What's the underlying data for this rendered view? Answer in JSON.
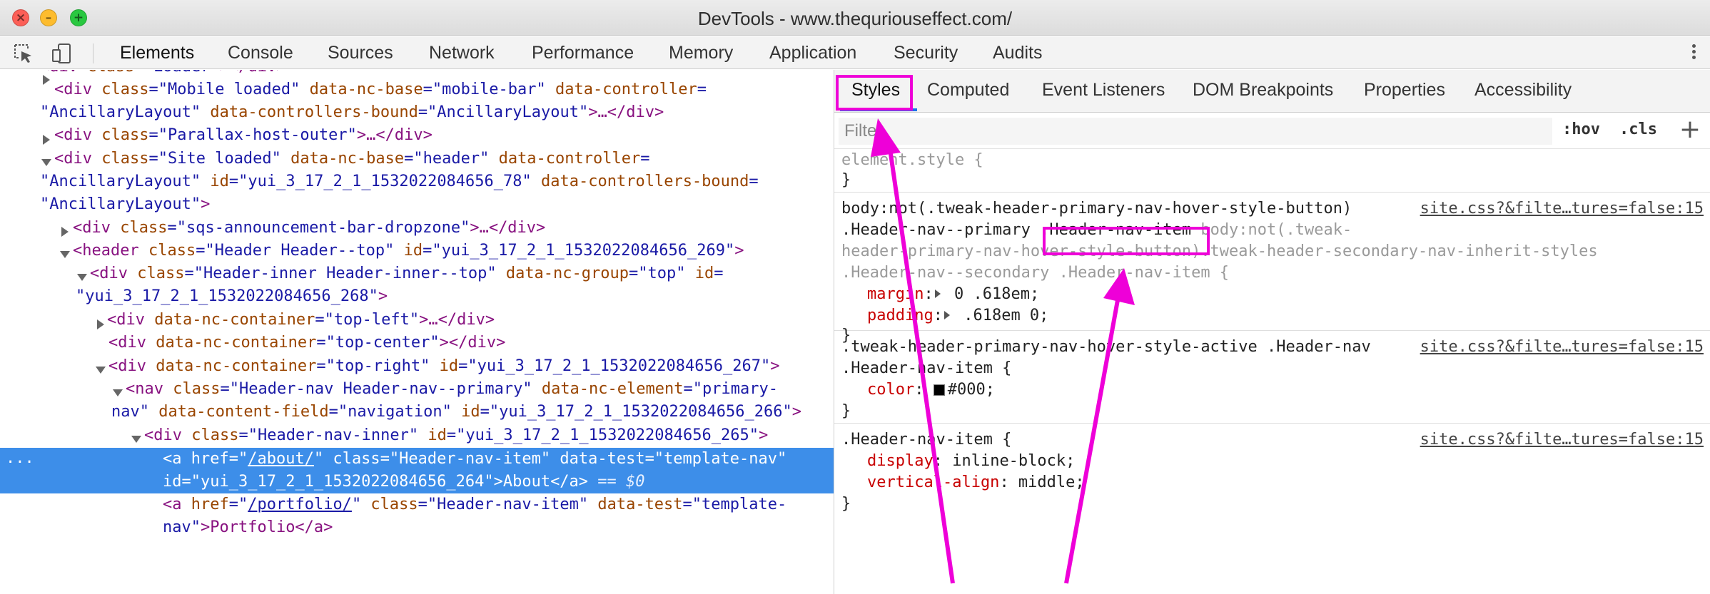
{
  "window": {
    "title": "DevTools - www.thequriouseffect.com/",
    "close_glyph": "×",
    "minimize_glyph": "–",
    "zoom_glyph": "+"
  },
  "toolbar": {
    "icons": [
      "inspect-element-icon",
      "device-toolbar-icon"
    ],
    "tabs": [
      "Elements",
      "Console",
      "Sources",
      "Network",
      "Performance",
      "Memory",
      "Application",
      "Security",
      "Audits"
    ],
    "active_tab": "Elements",
    "menu_icon": "kebab-menu-icon"
  },
  "dom_tree": {
    "lines": {
      "l0": {
        "open": "<",
        "tag": "div",
        "sp1": " ",
        "a1": "class",
        "eq": "=\"",
        "v1": "Loader",
        "close": "\"></div>"
      },
      "l1": {
        "o": "<",
        "t": "div",
        "a1": " class",
        "v1": "=\"Mobile loaded\"",
        "a2": " data-nc-base",
        "v2": "=\"mobile-bar\"",
        "a3": " data-controller",
        "v3": "="
      },
      "l2": {
        "v1": "\"AncillaryLayout\"",
        "a1": " data-controllers-bound",
        "v2": "=\"AncillaryLayout\"",
        "tx": ">…</div>"
      },
      "l3": {
        "o": "<",
        "t": "div",
        "a1": " class",
        "v1": "=\"Parallax-host-outer\"",
        "tx": ">…</div>"
      },
      "l4": {
        "o": "<",
        "t": "div",
        "a1": " class",
        "v1": "=\"Site loaded\"",
        "a2": " data-nc-base",
        "v2": "=\"header\"",
        "a3": " data-controller",
        "v3": "="
      },
      "l5": {
        "v1": "\"AncillaryLayout\"",
        "a1": " id",
        "v2": "=\"yui_3_17_2_1_1532022084656_78\"",
        "a2": " data-controllers-bound",
        "v3": "="
      },
      "l6": {
        "v1": "\"AncillaryLayout\"",
        "tx": ">"
      },
      "l7": {
        "o": "<",
        "t": "div",
        "a1": " class",
        "v1": "=\"sqs-announcement-bar-dropzone\"",
        "tx": ">…</div>"
      },
      "l8": {
        "o": "<",
        "t": "header",
        "a1": " class",
        "v1": "=\"Header Header--top\"",
        "a2": " id",
        "v2": "=\"yui_3_17_2_1_1532022084656_269\"",
        "tx": ">"
      },
      "l9": {
        "o": "<",
        "t": "div",
        "a1": " class",
        "v1": "=\"Header-inner Header-inner--top\"",
        "a2": " data-nc-group",
        "v2": "=\"top\"",
        "a3": " id",
        "v3": "="
      },
      "l10": {
        "v1": "\"yui_3_17_2_1_1532022084656_268\"",
        "tx": ">"
      },
      "l11": {
        "o": "<",
        "t": "div",
        "a1": " data-nc-container",
        "v1": "=\"top-left\"",
        "tx": ">…</div>"
      },
      "l12": {
        "o": "<",
        "t": "div",
        "a1": " data-nc-container",
        "v1": "=\"top-center\"",
        "tx": "></div>"
      },
      "l13": {
        "o": "<",
        "t": "div",
        "a1": " data-nc-container",
        "v1": "=\"top-right\"",
        "a2": " id",
        "v2": "=\"yui_3_17_2_1_1532022084656_267\"",
        "tx": ">"
      },
      "l14": {
        "o": "<",
        "t": "nav",
        "a1": " class",
        "v1": "=\"Header-nav Header-nav--primary\"",
        "a2": " data-nc-element",
        "v2": "=\"primary-"
      },
      "l15": {
        "v1": "nav\"",
        "a1": " data-content-field",
        "v2": "=\"navigation\"",
        "a2": " id",
        "v3": "=\"yui_3_17_2_1_1532022084656_266\"",
        "tx": ">"
      },
      "l16": {
        "o": "<",
        "t": "div",
        "a1": " class",
        "v1": "=\"Header-nav-inner\"",
        "a2": " id",
        "v2": "=\"yui_3_17_2_1_1532022084656_265\"",
        "tx": ">"
      },
      "l17": {
        "marker": "...",
        "o": "<",
        "t": "a",
        "a1": " href",
        "q1": "=\"",
        "lnk": "/about/",
        "q2": "\"",
        "a2": " class",
        "v2": "=\"Header-nav-item\"",
        "a3": " data-test",
        "v3": "=\"template-nav\""
      },
      "l18": {
        "a1": "id",
        "v1": "=\"yui_3_17_2_1_1532022084656_264\"",
        "tx": ">About</a>",
        "eq": " == $0"
      },
      "l19": {
        "o": "<",
        "t": "a",
        "a1": " href",
        "q1": "=\"",
        "lnk": "/portfolio/",
        "q2": "\"",
        "a2": " class",
        "v2": "=\"Header-nav-item\"",
        "a3": " data-test",
        "v3": "=\"template-"
      },
      "l20": {
        "v1": "nav\"",
        "tx": ">Portfolio</a>"
      }
    }
  },
  "side_pane": {
    "tabs": [
      "Styles",
      "Computed",
      "Event Listeners",
      "DOM Breakpoints",
      "Properties",
      "Accessibility"
    ],
    "active_tab": "Styles",
    "filter_placeholder": "Filter",
    "hov_label": ":hov",
    "cls_label": ".cls",
    "plus_label": "+",
    "rules": {
      "r0": {
        "sel": "element.style {",
        "close": "}"
      },
      "r1": {
        "sel1": "body:not(.tweak-header-primary-nav-hover-style-button)",
        "sel2a": ".Header-nav--primary ",
        "sel2b": ".Header-nav-item",
        "sel2c": " body:not(.tweak-",
        "sel3": "header-primary-nav-hover-style-button).tweak-header-secondary-nav-inherit-styles",
        "sel4": ".Header-nav--secondary .Header-nav-item {",
        "p1": "margin",
        "v1": " 0 .618em;",
        "p2": "padding",
        "v2": " .618em 0;",
        "close": "}",
        "source": "site.css?&filte…tures=false:15"
      },
      "r2": {
        "sel1": ".tweak-header-primary-nav-hover-style-active .Header-nav",
        "sel2": ".Header-nav-item {",
        "p1": "color",
        "v1": "#000;",
        "close": "}",
        "source": "site.css?&filte…tures=false:15"
      },
      "r3": {
        "sel1": ".Header-nav-item {",
        "p1": "display",
        "v1": " inline-block;",
        "p2": "vertical-align",
        "v2": " middle;",
        "close": "}",
        "source": "site.css?&filte…tures=false:15"
      }
    }
  },
  "colors": {
    "annotation": "#ee00d8",
    "selection": "#3d8ee9",
    "tag": "#881280",
    "attr_name": "#994500",
    "attr_value": "#1a1aa6",
    "css_property": "#c80000"
  }
}
